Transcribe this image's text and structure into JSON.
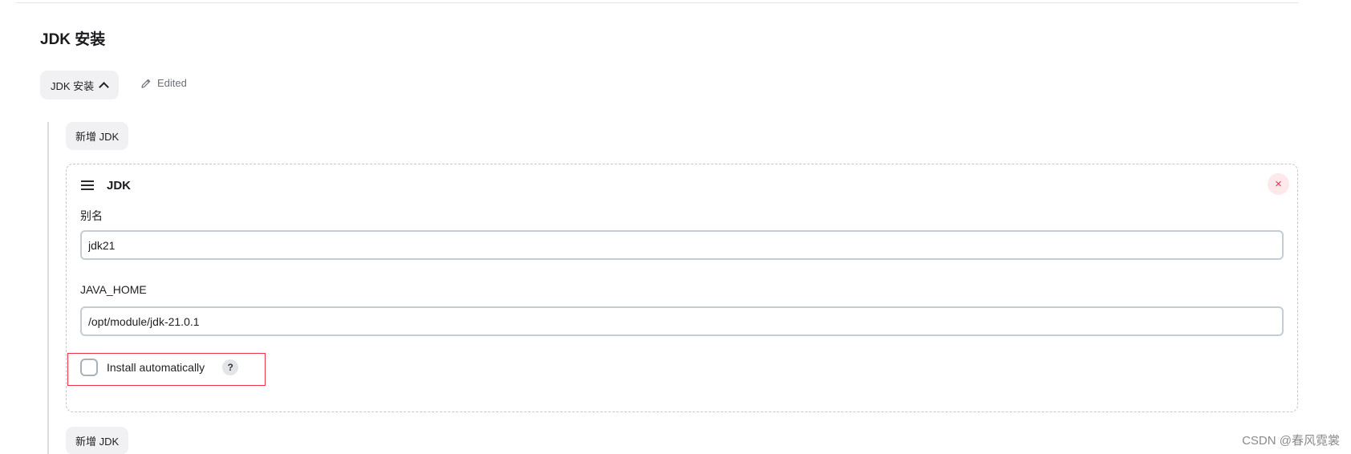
{
  "section": {
    "title": "JDK 安装"
  },
  "toggle": {
    "label": "JDK 安装"
  },
  "status": {
    "edited": "Edited"
  },
  "actions": {
    "add_jdk_top": "新增 JDK",
    "add_jdk_bottom": "新增 JDK"
  },
  "jdk_entry": {
    "title": "JDK",
    "remove_symbol": "×",
    "alias": {
      "label": "别名",
      "value": "jdk21"
    },
    "java_home": {
      "label": "JAVA_HOME",
      "value": "/opt/module/jdk-21.0.1"
    },
    "install_automatically": {
      "label": "Install automatically",
      "checked": false,
      "help": "?"
    }
  },
  "watermark": "CSDN @春风霓裳",
  "icons": {
    "toggle": "chevron-up-icon",
    "edited": "pencil-icon",
    "drag": "drag-handle-icon",
    "remove": "close-icon",
    "help": "help-icon"
  },
  "colors": {
    "remove_bg": "#fde8ea",
    "remove_fg": "#e0374f",
    "highlight_border": "#ee3344",
    "input_border": "#c3cdd3"
  }
}
